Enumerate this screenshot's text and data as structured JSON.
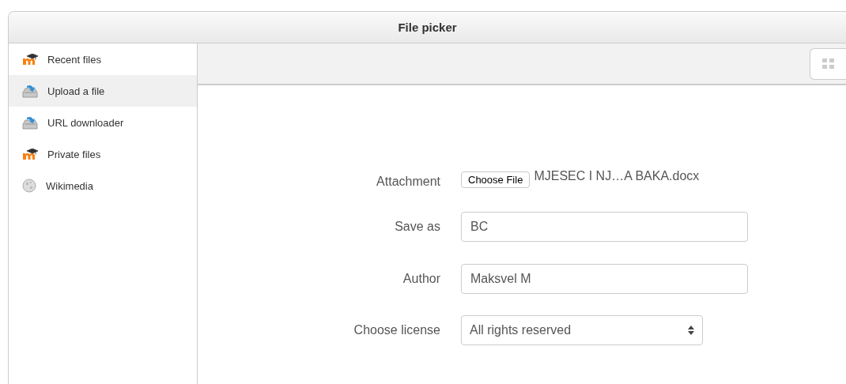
{
  "window": {
    "title": "File picker"
  },
  "sidebar": {
    "items": [
      {
        "label": "Recent files",
        "kind": "moodle",
        "selected": false
      },
      {
        "label": "Upload a file",
        "kind": "upload",
        "selected": true
      },
      {
        "label": "URL downloader",
        "kind": "upload",
        "selected": false
      },
      {
        "label": "Private files",
        "kind": "moodle",
        "selected": false
      },
      {
        "label": "Wikimedia",
        "kind": "globe",
        "selected": false
      }
    ]
  },
  "form": {
    "fields": [
      {
        "kind": "file",
        "label": "Attachment",
        "button": "Choose File",
        "value": "MJESEC I NJ…A BAKA.docx"
      },
      {
        "kind": "text",
        "label": "Save as",
        "value": "BC"
      },
      {
        "kind": "text",
        "label": "Author",
        "value": "Maksvel M"
      },
      {
        "kind": "select",
        "label": "Choose license",
        "value": "All rights reserved"
      }
    ]
  }
}
